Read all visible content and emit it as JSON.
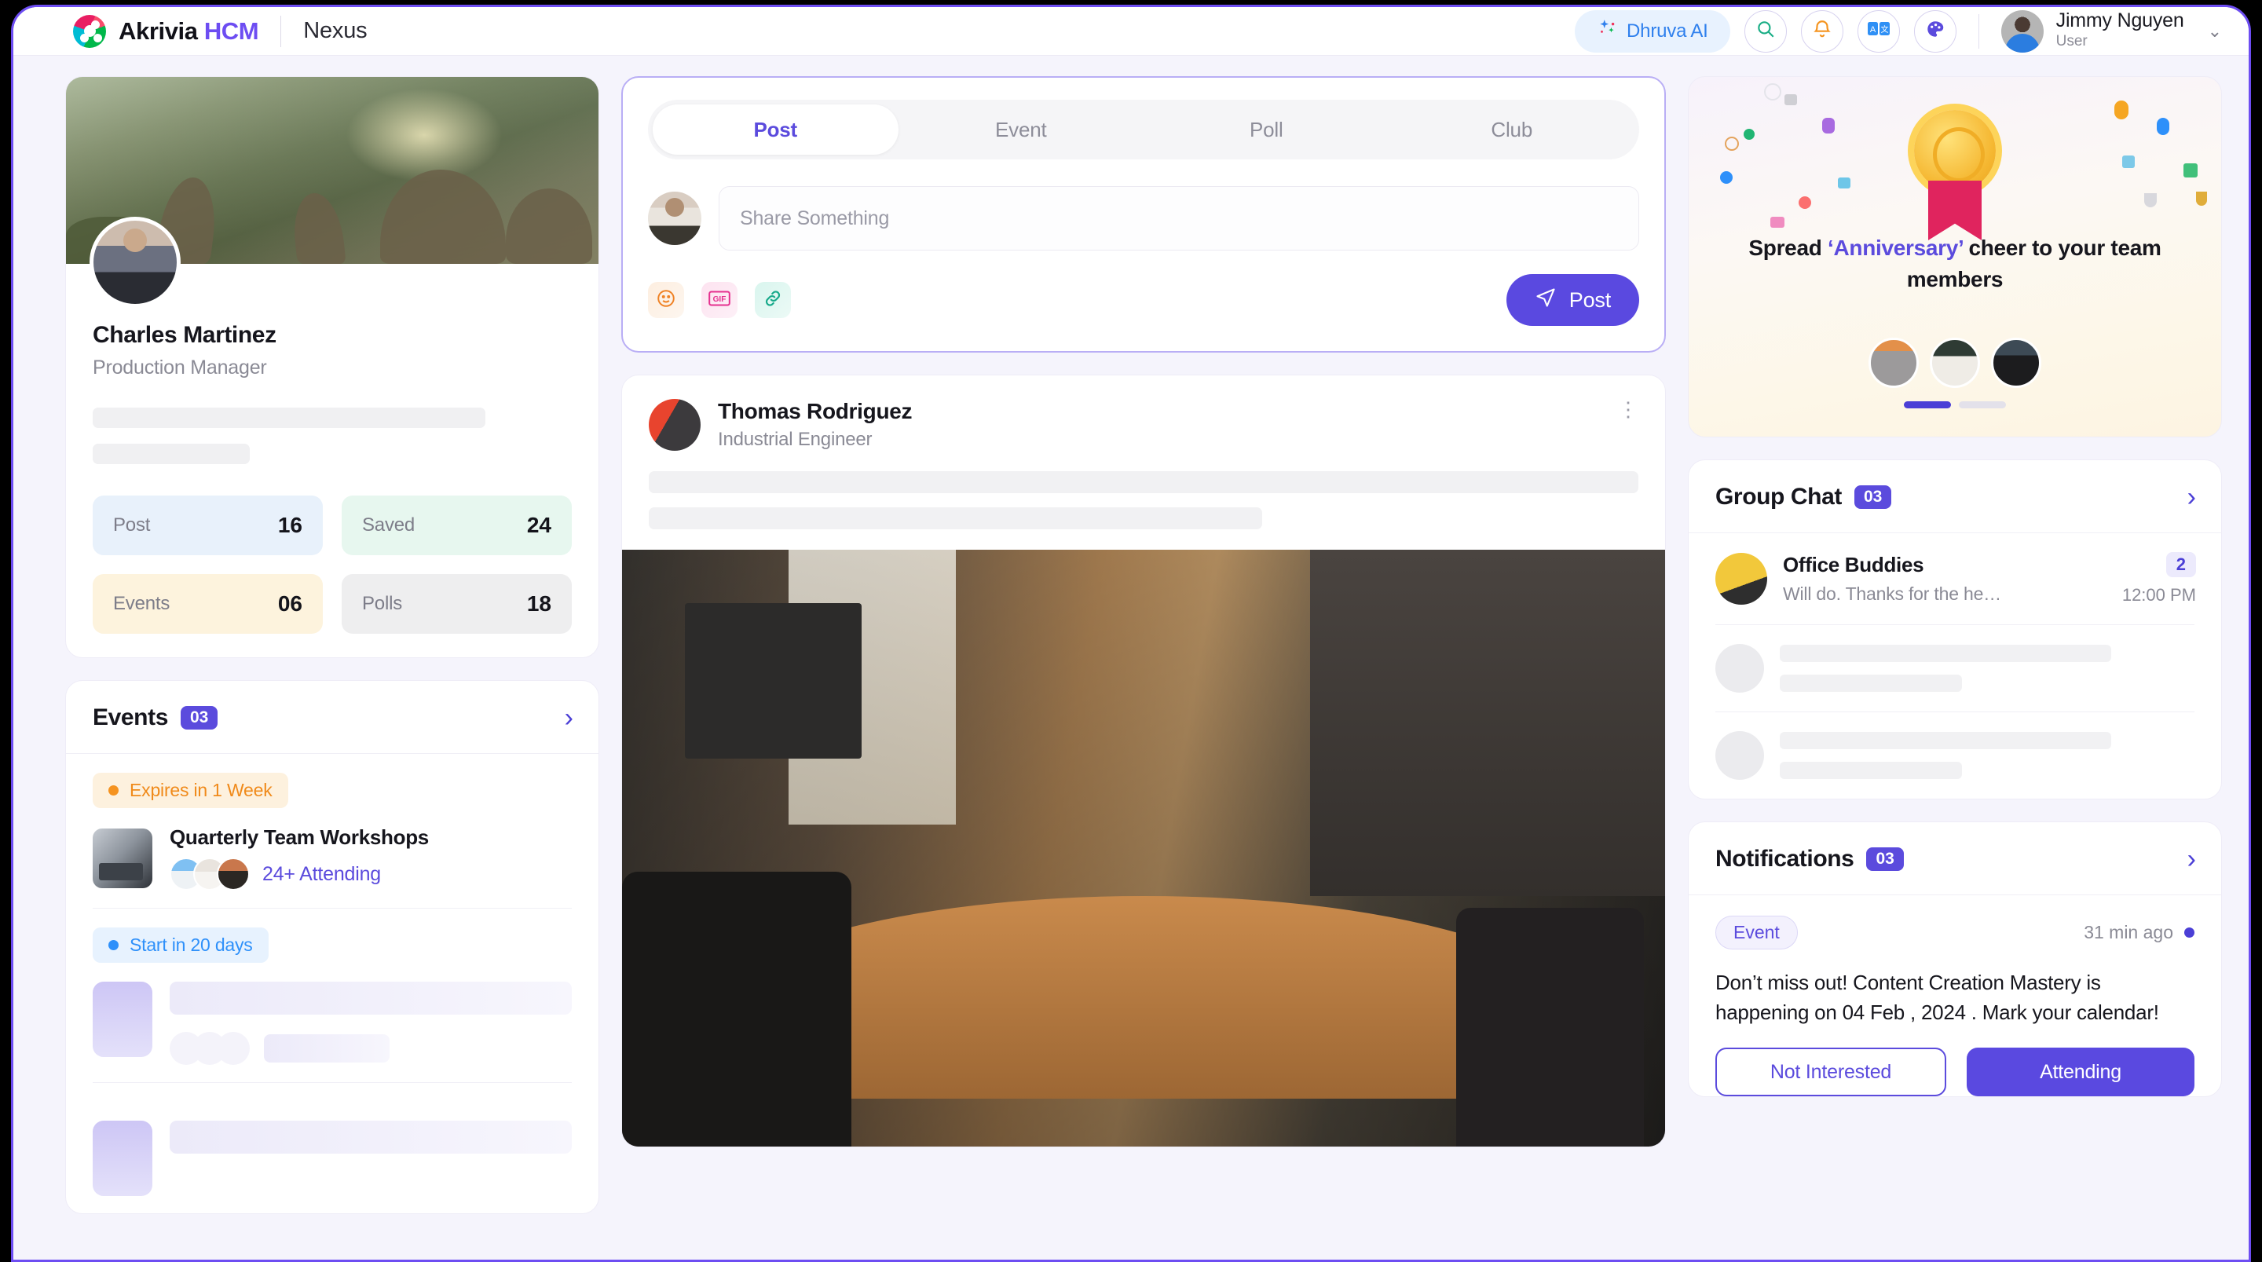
{
  "header": {
    "brand_first": "Akrivia ",
    "brand_second": "HCM",
    "app_name": "Nexus",
    "ai_label": "Dhruva AI",
    "icons": [
      "sparkle-icon",
      "search-icon",
      "bell-icon",
      "translate-icon",
      "palette-icon"
    ],
    "user": {
      "name": "Jimmy Nguyen",
      "role": "User"
    },
    "accent": "#5b4bdd"
  },
  "profile": {
    "name": "Charles Martinez",
    "role": "Production Manager",
    "stats": [
      {
        "label": "Post",
        "value": "16",
        "bg": "#e8f1fb"
      },
      {
        "label": "Saved",
        "value": "24",
        "bg": "#e7f7ef"
      },
      {
        "label": "Events",
        "value": "06",
        "bg": "#fdf3dd"
      },
      {
        "label": "Polls",
        "value": "18",
        "bg": "#eeeeef"
      }
    ]
  },
  "events": {
    "title": "Events",
    "count": "03",
    "items": [
      {
        "status": "Expires in 1 Week",
        "title": "Quarterly Team Workshops",
        "attending": "24+ Attending"
      },
      {
        "status": "Start in 20 days",
        "title": "",
        "attending": ""
      }
    ]
  },
  "composer": {
    "tabs": [
      {
        "label": "Post",
        "active": true
      },
      {
        "label": "Event",
        "active": false
      },
      {
        "label": "Poll",
        "active": false
      },
      {
        "label": "Club",
        "active": false
      }
    ],
    "placeholder": "Share Something",
    "value": "",
    "actions": [
      "emoji-icon",
      "gif-icon",
      "link-icon"
    ],
    "post_label": "Post"
  },
  "feed_post": {
    "author": "Thomas Rodriguez",
    "author_role": "Industrial Engineer"
  },
  "anniversary": {
    "text_before": "Spread ",
    "highlight": "‘Anniversary’",
    "text_after": " cheer to your team members",
    "slides": 2,
    "active_slide": 1
  },
  "group_chat": {
    "title": "Group Chat",
    "count": "03",
    "items": [
      {
        "name": "Office Buddies",
        "message": "Will do. Thanks for the he…",
        "unread": "2",
        "time": "12:00 PM"
      }
    ]
  },
  "notifications": {
    "title": "Notifications",
    "count": "03",
    "items": [
      {
        "tag": "Event",
        "time": "31 min ago",
        "text": "Don’t miss out! Content Creation Mastery is happening on 04 Feb , 2024 . Mark your calendar!",
        "decline_label": "Not Interested",
        "accept_label": "Attending"
      }
    ]
  }
}
